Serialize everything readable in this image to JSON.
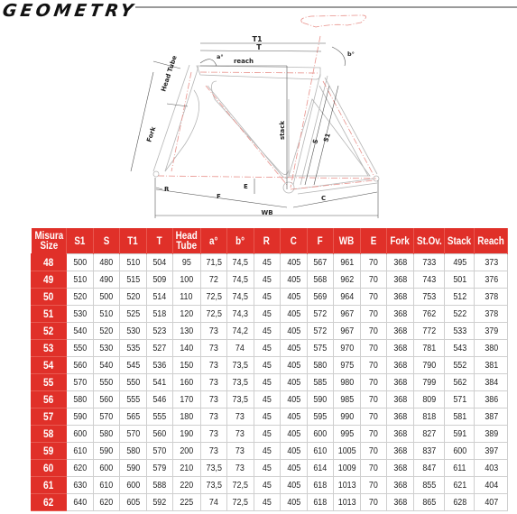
{
  "title": "GEOMETRY",
  "diagram": {
    "labels": {
      "t1": "T1",
      "t": "T",
      "reach": "reach",
      "a": "a°",
      "b": "b°",
      "head_tube": "Head Tube",
      "fork": "Fork",
      "stack": "stack",
      "s": "S",
      "s1": "S1",
      "r": "R",
      "e": "E",
      "f": "F",
      "c": "C",
      "wb": "WB"
    }
  },
  "table": {
    "headers": [
      [
        "Misura",
        "Size"
      ],
      [
        "S1"
      ],
      [
        "S"
      ],
      [
        "T1"
      ],
      [
        "T"
      ],
      [
        "Head",
        "Tube"
      ],
      [
        "a°"
      ],
      [
        "b°"
      ],
      [
        "R"
      ],
      [
        "C"
      ],
      [
        "F"
      ],
      [
        "WB"
      ],
      [
        "E"
      ],
      [
        "Fork"
      ],
      [
        "St.Ov."
      ],
      [
        "Stack"
      ],
      [
        "Reach"
      ]
    ],
    "rows": [
      [
        "48",
        "500",
        "480",
        "510",
        "504",
        "95",
        "71,5",
        "74,5",
        "45",
        "405",
        "567",
        "961",
        "70",
        "368",
        "733",
        "495",
        "373"
      ],
      [
        "49",
        "510",
        "490",
        "515",
        "509",
        "100",
        "72",
        "74,5",
        "45",
        "405",
        "568",
        "962",
        "70",
        "368",
        "743",
        "501",
        "376"
      ],
      [
        "50",
        "520",
        "500",
        "520",
        "514",
        "110",
        "72,5",
        "74,5",
        "45",
        "405",
        "569",
        "964",
        "70",
        "368",
        "753",
        "512",
        "378"
      ],
      [
        "51",
        "530",
        "510",
        "525",
        "518",
        "120",
        "72,5",
        "74,3",
        "45",
        "405",
        "572",
        "967",
        "70",
        "368",
        "762",
        "522",
        "378"
      ],
      [
        "52",
        "540",
        "520",
        "530",
        "523",
        "130",
        "73",
        "74,2",
        "45",
        "405",
        "572",
        "967",
        "70",
        "368",
        "772",
        "533",
        "379"
      ],
      [
        "53",
        "550",
        "530",
        "535",
        "527",
        "140",
        "73",
        "74",
        "45",
        "405",
        "575",
        "970",
        "70",
        "368",
        "781",
        "543",
        "380"
      ],
      [
        "54",
        "560",
        "540",
        "545",
        "536",
        "150",
        "73",
        "73,5",
        "45",
        "405",
        "580",
        "975",
        "70",
        "368",
        "790",
        "552",
        "381"
      ],
      [
        "55",
        "570",
        "550",
        "550",
        "541",
        "160",
        "73",
        "73,5",
        "45",
        "405",
        "585",
        "980",
        "70",
        "368",
        "799",
        "562",
        "384"
      ],
      [
        "56",
        "580",
        "560",
        "555",
        "546",
        "170",
        "73",
        "73,5",
        "45",
        "405",
        "590",
        "985",
        "70",
        "368",
        "809",
        "571",
        "386"
      ],
      [
        "57",
        "590",
        "570",
        "565",
        "555",
        "180",
        "73",
        "73",
        "45",
        "405",
        "595",
        "990",
        "70",
        "368",
        "818",
        "581",
        "387"
      ],
      [
        "58",
        "600",
        "580",
        "570",
        "560",
        "190",
        "73",
        "73",
        "45",
        "405",
        "600",
        "995",
        "70",
        "368",
        "827",
        "591",
        "389"
      ],
      [
        "59",
        "610",
        "590",
        "580",
        "570",
        "200",
        "73",
        "73",
        "45",
        "405",
        "610",
        "1005",
        "70",
        "368",
        "837",
        "600",
        "397"
      ],
      [
        "60",
        "620",
        "600",
        "590",
        "579",
        "210",
        "73,5",
        "73",
        "45",
        "405",
        "614",
        "1009",
        "70",
        "368",
        "847",
        "611",
        "403"
      ],
      [
        "61",
        "630",
        "610",
        "600",
        "588",
        "220",
        "73,5",
        "72,5",
        "45",
        "405",
        "618",
        "1013",
        "70",
        "368",
        "855",
        "621",
        "404"
      ],
      [
        "62",
        "640",
        "620",
        "605",
        "592",
        "225",
        "74",
        "72,5",
        "45",
        "405",
        "618",
        "1013",
        "70",
        "368",
        "865",
        "628",
        "407"
      ]
    ]
  },
  "colors": {
    "header_red": "#e03029",
    "frame_red": "#e8908a",
    "frame_gray": "#b0b0b0"
  }
}
